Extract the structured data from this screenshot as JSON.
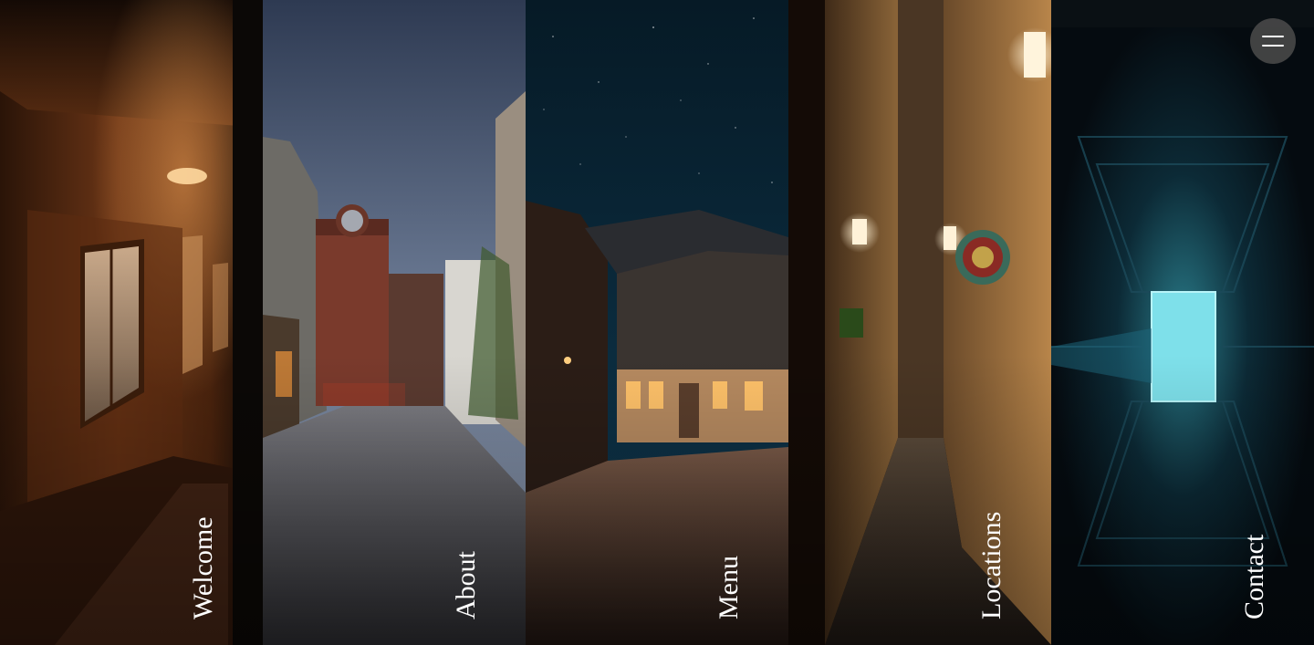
{
  "panels": [
    {
      "id": "welcome",
      "label": "Welcome",
      "scene": "train-corridor-night"
    },
    {
      "id": "about",
      "label": "About",
      "scene": "cobblestone-street-dusk"
    },
    {
      "id": "menu",
      "label": "Menu",
      "scene": "starry-night-village"
    },
    {
      "id": "locations",
      "label": "Locations",
      "scene": "narrow-alley-lanterns"
    },
    {
      "id": "contact",
      "label": "Contact",
      "scene": "courtyard-looking-up"
    }
  ],
  "menu_button": {
    "icon": "hamburger-icon"
  },
  "colors": {
    "label": "#ffffff",
    "menu_button_bg": "#484848"
  }
}
